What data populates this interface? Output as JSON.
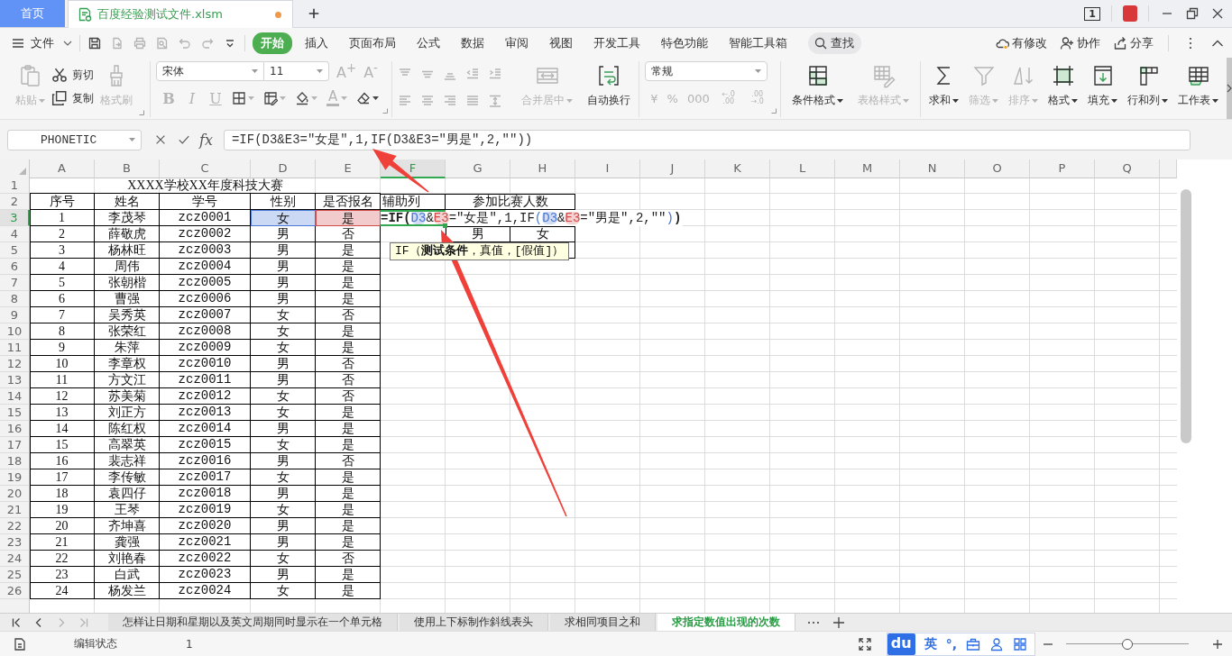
{
  "tab_bar": {
    "home": "首页",
    "document": {
      "title": "百度经验测试文件.xlsm",
      "unsaved": true
    },
    "window_count": "1"
  },
  "menu": {
    "file": "文件",
    "quick_access": [
      {
        "disabled": false
      },
      {
        "disabled": true
      },
      {
        "disabled": true
      },
      {
        "disabled": true
      },
      {
        "disabled": true
      },
      {
        "disabled": true
      },
      {
        "disabled": false
      }
    ],
    "tabs": [
      {
        "label": "开始",
        "selected": true
      },
      {
        "label": "插入",
        "selected": false
      },
      {
        "label": "页面布局",
        "selected": false
      },
      {
        "label": "公式",
        "selected": false
      },
      {
        "label": "数据",
        "selected": false
      },
      {
        "label": "审阅",
        "selected": false
      },
      {
        "label": "视图",
        "selected": false
      },
      {
        "label": "开发工具",
        "selected": false
      },
      {
        "label": "特色功能",
        "selected": false
      },
      {
        "label": "智能工具箱",
        "selected": false
      }
    ],
    "search": "查找",
    "actions": [
      {
        "label": "有修改"
      },
      {
        "label": "协作"
      },
      {
        "label": "分享"
      }
    ]
  },
  "ribbon": {
    "paste": {
      "label": "粘贴",
      "disabled": true
    },
    "cut": {
      "label": "剪切",
      "disabled": false
    },
    "copy": {
      "label": "复制",
      "disabled": false
    },
    "format_painter": {
      "label": "格式刷",
      "disabled": true
    },
    "font_name": "宋体",
    "font_size": "11",
    "font_size_buttons": [
      {
        "label": "A$^{+}$",
        "disabled": true
      },
      {
        "label": "A$^{-}$",
        "disabled": true
      }
    ],
    "style_buttons": [
      {
        "label": "B",
        "disabled": true
      },
      {
        "label": "I",
        "disabled": true
      },
      {
        "label": "U",
        "disabled": true
      }
    ],
    "font_tools": [
      {
        "disabled": true
      },
      {
        "disabled": true
      },
      {
        "disabled": true
      }
    ],
    "font_color": {
      "label": "A",
      "disabled": true
    },
    "eraser": {
      "disabled": false
    },
    "align_buttons": [
      {
        "disabled": true
      },
      {
        "disabled": true
      },
      {
        "disabled": true
      },
      {
        "disabled": true
      },
      {
        "disabled": true
      },
      {
        "disabled": true
      },
      {
        "disabled": true
      },
      {
        "disabled": true
      },
      {
        "disabled": true
      },
      {
        "disabled": true
      }
    ],
    "merge": {
      "label": "合并居中",
      "disabled": true
    },
    "wrap": {
      "label": "自动换行",
      "disabled": false
    },
    "number_format": "常规",
    "number_buttons": [
      {
        "label": "¥",
        "disabled": true
      },
      {
        "label": "%",
        "disabled": true
      },
      {
        "label": "000",
        "disabled": true
      },
      {
        "label": "←.0 .00",
        "disabled": true
      },
      {
        "label": ".00 →.0",
        "disabled": true
      }
    ],
    "styles": [
      {
        "label": "条件格式",
        "disabled": false
      },
      {
        "label": "表格样式",
        "disabled": true
      }
    ],
    "tools": [
      {
        "label": "求和",
        "disabled": false
      },
      {
        "label": "筛选",
        "disabled": true
      },
      {
        "label": "排序",
        "disabled": true
      },
      {
        "label": "格式",
        "disabled": false
      },
      {
        "label": "填充",
        "disabled": false
      },
      {
        "label": "行和列",
        "disabled": false
      },
      {
        "label": "工作表",
        "disabled": false
      }
    ]
  },
  "formula_bar": {
    "name_box": "PHONETIC",
    "fx": "fx",
    "formula": "=IF(D3&E3=\"女是\",1,IF(D3&E3=\"男是\",2,\"\"))"
  },
  "sheet": {
    "columns": [
      {
        "label": "A",
        "selected": false
      },
      {
        "label": "B",
        "selected": false
      },
      {
        "label": "C",
        "selected": false
      },
      {
        "label": "D",
        "selected": false
      },
      {
        "label": "E",
        "selected": false
      },
      {
        "label": "F",
        "selected": true
      },
      {
        "label": "G",
        "selected": false
      },
      {
        "label": "H",
        "selected": false
      },
      {
        "label": "I",
        "selected": false
      },
      {
        "label": "J",
        "selected": false
      },
      {
        "label": "K",
        "selected": false
      },
      {
        "label": "L",
        "selected": false
      },
      {
        "label": "M",
        "selected": false
      },
      {
        "label": "N",
        "selected": false
      },
      {
        "label": "O",
        "selected": false
      },
      {
        "label": "P",
        "selected": false
      },
      {
        "label": "Q",
        "selected": false
      }
    ],
    "rows": [
      {
        "label": "1",
        "selected": false
      },
      {
        "label": "2",
        "selected": false
      },
      {
        "label": "3",
        "selected": true
      },
      {
        "label": "4",
        "selected": false
      },
      {
        "label": "5",
        "selected": false
      },
      {
        "label": "6",
        "selected": false
      },
      {
        "label": "7",
        "selected": false
      },
      {
        "label": "8",
        "selected": false
      },
      {
        "label": "9",
        "selected": false
      },
      {
        "label": "10",
        "selected": false
      },
      {
        "label": "11",
        "selected": false
      },
      {
        "label": "12",
        "selected": false
      },
      {
        "label": "13",
        "selected": false
      },
      {
        "label": "14",
        "selected": false
      },
      {
        "label": "15",
        "selected": false
      },
      {
        "label": "16",
        "selected": false
      },
      {
        "label": "17",
        "selected": false
      },
      {
        "label": "18",
        "selected": false
      },
      {
        "label": "19",
        "selected": false
      },
      {
        "label": "20",
        "selected": false
      },
      {
        "label": "21",
        "selected": false
      },
      {
        "label": "22",
        "selected": false
      },
      {
        "label": "23",
        "selected": false
      },
      {
        "label": "24",
        "selected": false
      },
      {
        "label": "25",
        "selected": false
      },
      {
        "label": "26",
        "selected": false
      }
    ],
    "title": "XXXX学校XX年度科技大赛",
    "headers": [
      "序号",
      "姓名",
      "学号",
      "性别",
      "是否报名"
    ],
    "helper_header": "辅助列",
    "count_header": "参加比赛人数",
    "count_labels": [
      "男",
      "女"
    ],
    "records": [
      {
        "no": "1",
        "name": "李茂琴",
        "id": "zcz0001",
        "gender": {
          "text": "女",
          "color": "#4a78d6"
        },
        "registered": {
          "text": "是",
          "color": "#d24a4a"
        }
      },
      {
        "no": "2",
        "name": "薛敬虎",
        "id": "zcz0002",
        "gender": "男",
        "registered": "否"
      },
      {
        "no": "3",
        "name": "杨林旺",
        "id": "zcz0003",
        "gender": "男",
        "registered": "是"
      },
      {
        "no": "4",
        "name": "周伟",
        "id": "zcz0004",
        "gender": "男",
        "registered": "是"
      },
      {
        "no": "5",
        "name": "张朝楷",
        "id": "zcz0005",
        "gender": "男",
        "registered": "是"
      },
      {
        "no": "6",
        "name": "曹强",
        "id": "zcz0006",
        "gender": "男",
        "registered": "是"
      },
      {
        "no": "7",
        "name": "吴秀英",
        "id": "zcz0007",
        "gender": "女",
        "registered": "否"
      },
      {
        "no": "8",
        "name": "张荣红",
        "id": "zcz0008",
        "gender": "女",
        "registered": "是"
      },
      {
        "no": "9",
        "name": "朱萍",
        "id": "zcz0009",
        "gender": "女",
        "registered": "是"
      },
      {
        "no": "10",
        "name": "李章权",
        "id": "zcz0010",
        "gender": "男",
        "registered": "否"
      },
      {
        "no": "11",
        "name": "方文江",
        "id": "zcz0011",
        "gender": "男",
        "registered": "否"
      },
      {
        "no": "12",
        "name": "苏美菊",
        "id": "zcz0012",
        "gender": "女",
        "registered": "否"
      },
      {
        "no": "13",
        "name": "刘正方",
        "id": "zcz0013",
        "gender": "女",
        "registered": "是"
      },
      {
        "no": "14",
        "name": "陈红权",
        "id": "zcz0014",
        "gender": "男",
        "registered": "是"
      },
      {
        "no": "15",
        "name": "高翠英",
        "id": "zcz0015",
        "gender": "女",
        "registered": "是"
      },
      {
        "no": "16",
        "name": "裴志祥",
        "id": "zcz0016",
        "gender": "男",
        "registered": "否"
      },
      {
        "no": "17",
        "name": "李传敏",
        "id": "zcz0017",
        "gender": "女",
        "registered": "是"
      },
      {
        "no": "18",
        "name": "袁四仔",
        "id": "zcz0018",
        "gender": "男",
        "registered": "是"
      },
      {
        "no": "19",
        "name": "王琴",
        "id": "zcz0019",
        "gender": "女",
        "registered": "是"
      },
      {
        "no": "20",
        "name": "齐坤喜",
        "id": "zcz0020",
        "gender": "男",
        "registered": "是"
      },
      {
        "no": "21",
        "name": "龚强",
        "id": "zcz0021",
        "gender": "男",
        "registered": "是"
      },
      {
        "no": "22",
        "name": "刘艳春",
        "id": "zcz0022",
        "gender": "女",
        "registered": "否"
      },
      {
        "no": "23",
        "name": "白武",
        "id": "zcz0023",
        "gender": "男",
        "registered": "是"
      },
      {
        "no": "24",
        "name": "杨发兰",
        "id": "zcz0024",
        "gender": "女",
        "registered": "是"
      }
    ],
    "editor": {
      "tokens": [
        {
          "text": "=IF(",
          "kind": "bold"
        },
        {
          "text": "D3",
          "kind": "ref",
          "color": "#4a78d6"
        },
        {
          "text": "&",
          "kind": "plain"
        },
        {
          "text": "E3",
          "kind": "ref",
          "color": "#d24a4a"
        },
        {
          "text": "=\"女是\",1,IF",
          "kind": "plain"
        },
        {
          "text": "(",
          "kind": "paren",
          "color": "#4a78d6"
        },
        {
          "text": "D3",
          "kind": "ref",
          "color": "#4a78d6"
        },
        {
          "text": "&",
          "kind": "plain"
        },
        {
          "text": "E3",
          "kind": "ref",
          "color": "#d24a4a"
        },
        {
          "text": "=\"男是\",2,\"\"",
          "kind": "plain"
        },
        {
          "text": ")",
          "kind": "paren",
          "color": "#4a78d6"
        },
        {
          "text": ")",
          "kind": "bold"
        }
      ],
      "tooltip": "IF（**测试条件**，真值，[假值]）"
    }
  },
  "sheet_tabs": {
    "nav": [
      {
        "disabled": false
      },
      {
        "disabled": false
      },
      {
        "disabled": true
      },
      {
        "disabled": true
      }
    ],
    "tabs": [
      {
        "label": "怎样让日期和星期以及英文周期同时显示在一个单元格",
        "selected": false
      },
      {
        "label": "使用上下标制作斜线表头",
        "selected": false
      },
      {
        "label": "求相同项目之和",
        "selected": false
      },
      {
        "label": "求指定数值出现的次数",
        "selected": true
      }
    ]
  },
  "status_bar": {
    "mode": "编辑状态",
    "count": "1",
    "ime": {
      "logo": "du",
      "language": "英",
      "punctuation": "°,"
    },
    "zoom": {
      "level": 0.5
    }
  }
}
